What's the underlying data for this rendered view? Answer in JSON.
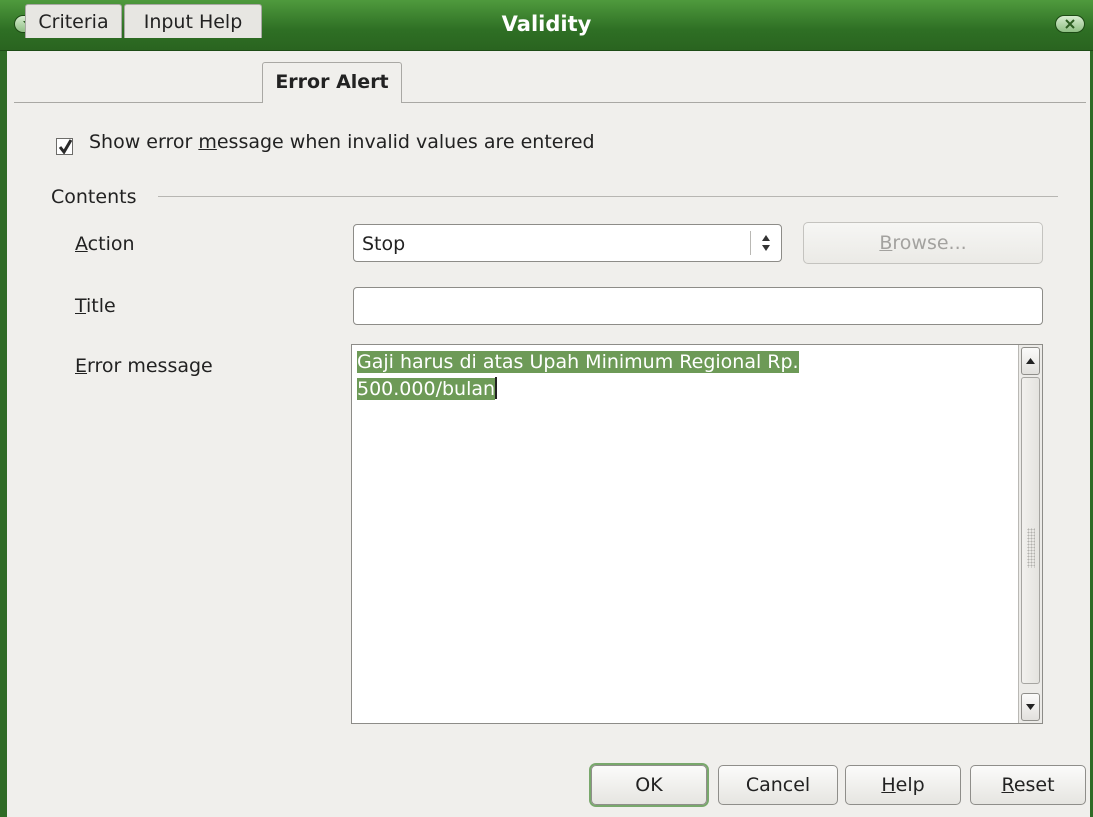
{
  "window": {
    "title": "Validity"
  },
  "tabs": [
    {
      "label": "Criteria"
    },
    {
      "label": "Input Help"
    },
    {
      "label": "Error Alert"
    }
  ],
  "show_error": {
    "checked": true,
    "label_before": "Show error ",
    "label_mnemonic": "m",
    "label_after": "essage when invalid values are entered"
  },
  "contents": {
    "section_label": "Contents",
    "action": {
      "mnemonic": "A",
      "label_rest": "ction",
      "value": "Stop"
    },
    "browse": {
      "mnemonic": "B",
      "label_rest": "rowse..."
    },
    "title": {
      "mnemonic": "T",
      "label_rest": "itle",
      "value": ""
    },
    "error_message": {
      "mnemonic": "E",
      "label_rest": "rror message",
      "line1": "Gaji harus di atas Upah Minimum Regional Rp.",
      "line2": "500.000/bulan"
    }
  },
  "buttons": {
    "ok": "OK",
    "cancel": "Cancel",
    "help": {
      "mnemonic": "H",
      "rest": "elp"
    },
    "reset": {
      "mnemonic": "R",
      "rest": "eset"
    }
  },
  "colors": {
    "titlebar": "#2e6f24",
    "selection": "#6d9a57"
  }
}
